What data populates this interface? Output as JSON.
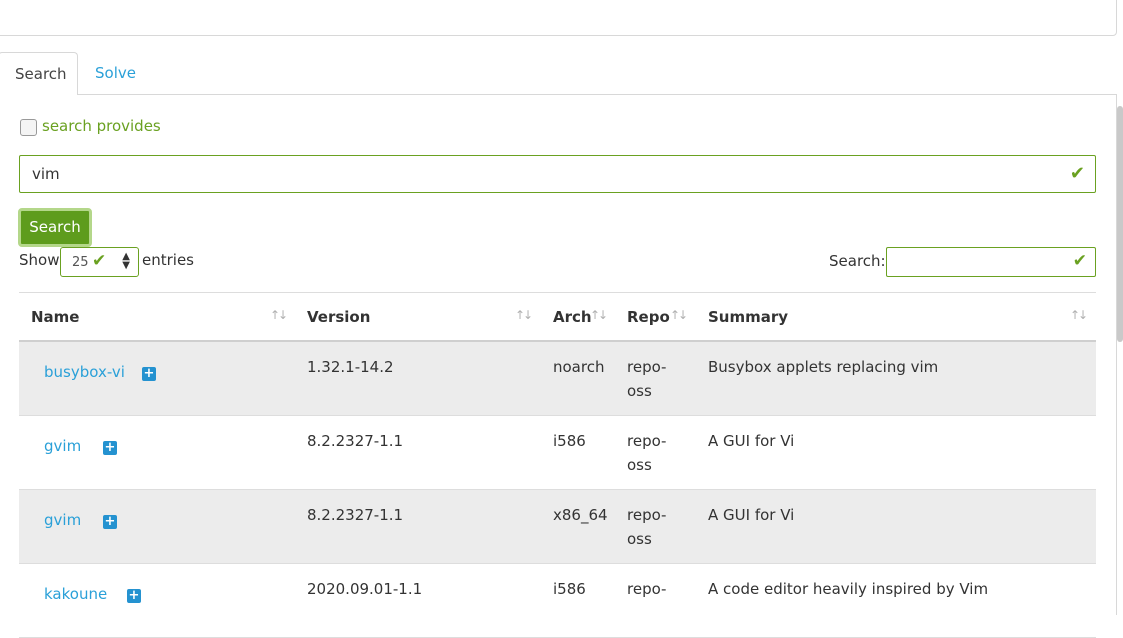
{
  "tabs": [
    {
      "label": "Search",
      "active": true
    },
    {
      "label": "Solve",
      "active": false
    }
  ],
  "search_provides": {
    "label": "search provides",
    "checked": false
  },
  "query": {
    "value": "vim"
  },
  "search_button": {
    "label": "Search"
  },
  "length_menu": {
    "show_label": "Show",
    "value": "25",
    "entries_label": "entries"
  },
  "filter": {
    "label": "Search:",
    "value": ""
  },
  "table": {
    "columns": [
      "Name",
      "Version",
      "Arch",
      "Repo",
      "Summary"
    ],
    "rows": [
      {
        "name": "busybox-vi",
        "version": "1.32.1-14.2",
        "arch": "noarch",
        "repo_line1": "repo-",
        "repo_line2": "oss",
        "summary": "Busybox applets replacing vim"
      },
      {
        "name": "gvim",
        "version": "8.2.2327-1.1",
        "arch": "i586",
        "repo_line1": "repo-",
        "repo_line2": "oss",
        "summary": "A GUI for Vi"
      },
      {
        "name": "gvim",
        "version": "8.2.2327-1.1",
        "arch": "x86_64",
        "repo_line1": "repo-",
        "repo_line2": "oss",
        "summary": "A GUI for Vi"
      },
      {
        "name": "kakoune",
        "version": "2020.09.01-1.1",
        "arch": "i586",
        "repo_line1": "repo-",
        "repo_line2": "",
        "summary": "A code editor heavily inspired by Vim"
      }
    ]
  },
  "colors": {
    "accent_green": "#6aa121",
    "button_green": "#5e9c1d",
    "link_blue": "#2aa0d8",
    "plus_blue": "#2492d0"
  },
  "icons": {
    "valid": "check-icon",
    "expand": "plus-square-icon",
    "sort": "sort-arrows-icon",
    "select": "updown-arrows-icon"
  }
}
